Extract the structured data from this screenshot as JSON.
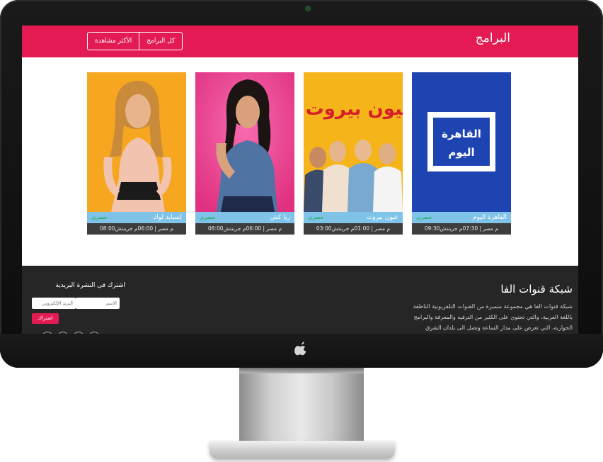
{
  "header": {
    "title": "البرامج",
    "tabs": [
      {
        "label": "كل البرامج"
      },
      {
        "label": "الأكثر مشاهدة"
      }
    ]
  },
  "programs": [
    {
      "name": "القاهرة اليوم",
      "badge": "حصري",
      "time": "09:30م مصر | 07:30م جرينتش",
      "poster_text": "القاهرة اليوم",
      "bg": "#1e44b2"
    },
    {
      "name": "عيون بيروت",
      "badge": "حصري",
      "time": "03:00م مصر | 01:00م جرينتش",
      "poster_text": "عيون بيروت",
      "bg": "#f5b51a"
    },
    {
      "name": "ريا كش",
      "badge": "حصري",
      "time": "08:00م مصر | 06:00م جرينتش",
      "bg": "#ec3f95"
    },
    {
      "name": "إنسايد لوك",
      "badge": "حصري",
      "time": "08:00م مصر | 06:00م جرينتش",
      "bg": "#f6a71f"
    }
  ],
  "footer": {
    "title": "شبكة قنوات الفا",
    "description": "شبكة قنوات الفا هي مجموعة متميزة من القنوات التلفزيونية الناطقة باللغة العربية، والتي تحتوي على الكثير من الترفيه والمعرفة والبرامج الحوارية، التي تعرض على مدار الساعة وتصل الى بلدان الشرق الأوسط، وشمال افريقيا وبقية دول العالم.",
    "newsletter_title": "اشترك فى النشرة البريدية",
    "name_placeholder": "الاسم",
    "email_placeholder": "البريد الإلكتروني",
    "subscribe_label": "اشتراك"
  },
  "colors": {
    "accent": "#e31b52",
    "name_bar": "#7fc4e8",
    "badge": "#1fa858",
    "time_bar": "#3d3d3d",
    "footer_bg": "#262626"
  }
}
